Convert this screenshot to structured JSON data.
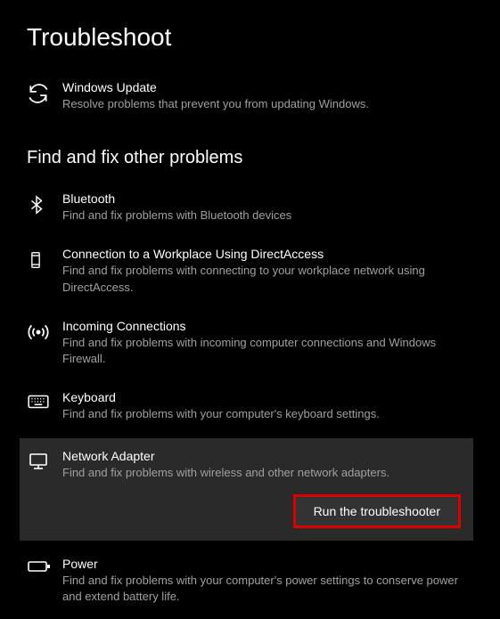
{
  "page": {
    "title": "Troubleshoot",
    "section_other": "Find and fix other problems"
  },
  "items": {
    "windows_update": {
      "title": "Windows Update",
      "desc": "Resolve problems that prevent you from updating Windows."
    },
    "bluetooth": {
      "title": "Bluetooth",
      "desc": "Find and fix problems with Bluetooth devices"
    },
    "direct_access": {
      "title": "Connection to a Workplace Using DirectAccess",
      "desc": "Find and fix problems with connecting to your workplace network using DirectAccess."
    },
    "incoming": {
      "title": "Incoming Connections",
      "desc": "Find and fix problems with incoming computer connections and Windows Firewall."
    },
    "keyboard": {
      "title": "Keyboard",
      "desc": "Find and fix problems with your computer's keyboard settings."
    },
    "network_adapter": {
      "title": "Network Adapter",
      "desc": "Find and fix problems with wireless and other network adapters."
    },
    "power": {
      "title": "Power",
      "desc": "Find and fix problems with your computer's power settings to conserve power and extend battery life."
    }
  },
  "buttons": {
    "run_troubleshooter": "Run the troubleshooter"
  }
}
